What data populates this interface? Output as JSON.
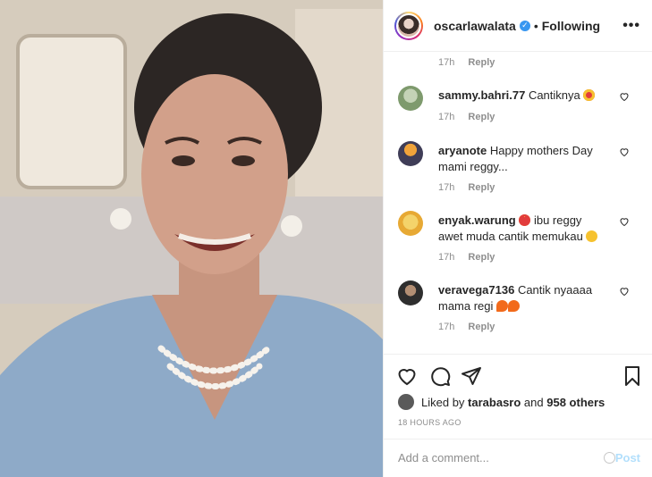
{
  "post": {
    "username": "oscarlawalata",
    "separator": "•",
    "follow_status": "Following",
    "more_icon": "more-icon"
  },
  "comments": [
    {
      "username": "",
      "text": "",
      "time": "17h",
      "reply": "Reply"
    },
    {
      "username": "sammy.bahri.77",
      "text": "Cantiknya",
      "time": "17h",
      "reply": "Reply"
    },
    {
      "username": "aryanote",
      "text": "Happy mothers Day mami reggy...",
      "time": "17h",
      "reply": "Reply"
    },
    {
      "username": "enyak.warung",
      "text": "ibu reggy awet muda cantik memukau",
      "time": "17h",
      "reply": "Reply"
    },
    {
      "username": "veravega7136",
      "text": "Cantik nyaaaa mama regi",
      "time": "17h",
      "reply": "Reply"
    }
  ],
  "likes": {
    "prefix": "Liked by",
    "user": "tarabasro",
    "conj": "and",
    "others": "958 others"
  },
  "timestamp": "18 HOURS AGO",
  "add_comment": {
    "placeholder": "Add a comment...",
    "post_label": "Post"
  },
  "colors": {
    "accent": "#3897f0",
    "post_disabled": "#b2dffc",
    "muted": "#8e8e8e"
  }
}
